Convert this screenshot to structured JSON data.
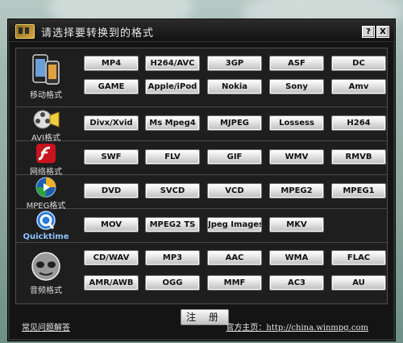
{
  "title": "请选择要转换到的格式",
  "titlebar_buttons": {
    "help": "?",
    "close": "X"
  },
  "categories": [
    {
      "label": "移动格式",
      "icon": "mobile-phone-icon",
      "formats": [
        "MP4",
        "H264/AVC",
        "3GP",
        "ASF",
        "DC",
        "GAME",
        "Apple/iPod",
        "Nokia",
        "Sony",
        "Amv"
      ]
    },
    {
      "label": "AVI格式",
      "icon": "film-reel-icon",
      "formats": [
        "Divx/Xvid",
        "Ms Mpeg4",
        "MJPEG",
        "Lossess",
        "H264"
      ]
    },
    {
      "label": "网络格式",
      "icon": "flash-icon",
      "formats": [
        "SWF",
        "FLV",
        "GIF",
        "WMV",
        "RMVB"
      ]
    },
    {
      "label": "MPEG格式",
      "icon": "mpeg-disc-icon",
      "formats": [
        "DVD",
        "SVCD",
        "VCD",
        "MPEG2",
        "MPEG1"
      ]
    },
    {
      "label": "Quicktime",
      "icon": "quicktime-icon",
      "formats": [
        "MOV",
        "MPEG2 TS",
        "Jpeg Images",
        "MKV"
      ]
    },
    {
      "label": "音频格式",
      "icon": "audio-player-icon",
      "formats": [
        "CD/WAV",
        "MP3",
        "AAC",
        "WMA",
        "FLAC",
        "AMR/AWB",
        "OGG",
        "MMF",
        "AC3",
        "AU"
      ]
    }
  ],
  "register_label": "注 册",
  "faq_link": "常见问题解答",
  "homepage_link": "官方主页：http://china.winmpg.com",
  "colors": {
    "dialog_bg": "#141414",
    "panel_bg": "#1e1e1e",
    "button_face": "#e8e8e8",
    "text_light": "#e8e8e8"
  }
}
